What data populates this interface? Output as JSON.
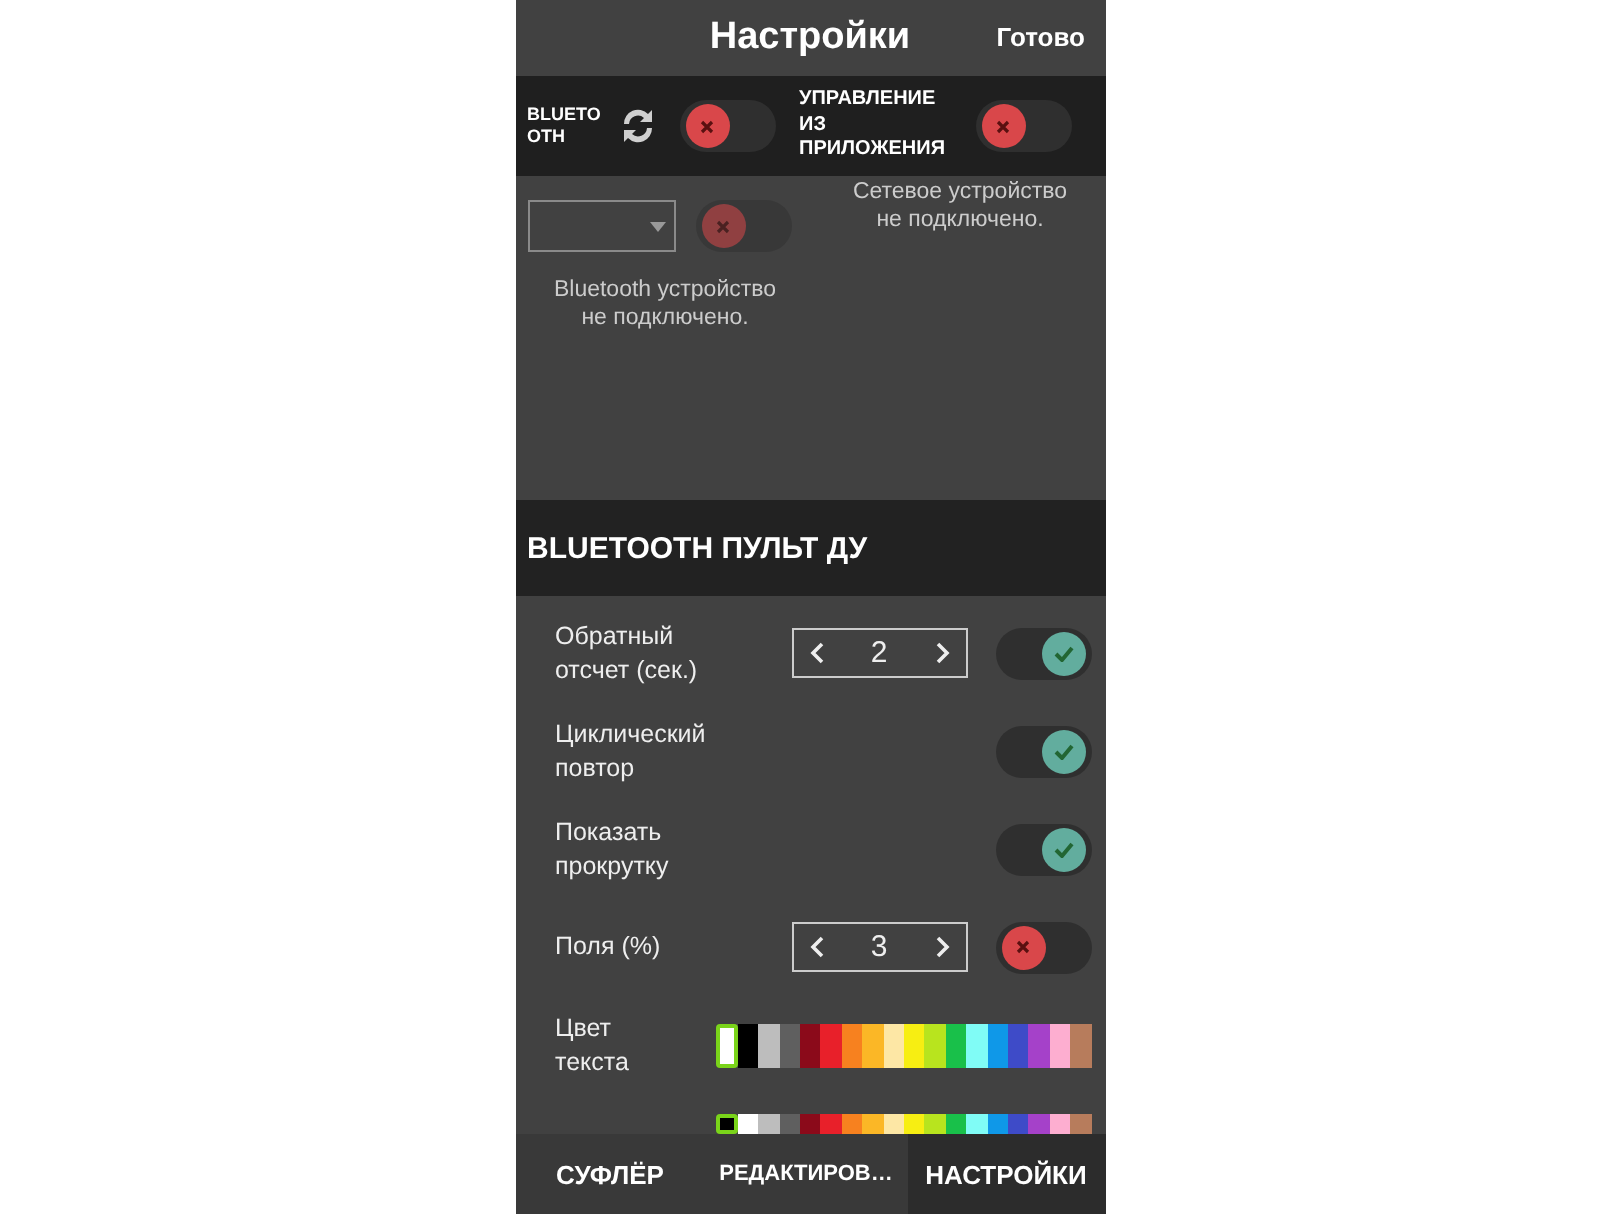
{
  "header": {
    "title": "Настройки",
    "done_button": "Готово"
  },
  "connection_bar": {
    "bluetooth": {
      "label": "BLUETOOTH",
      "on": false
    },
    "app_control": {
      "label": "УПРАВЛЕНИЕ ИЗ ПРИЛОЖЕНИЯ",
      "on": false
    }
  },
  "bluetooth_device": {
    "toggle_on": false,
    "disabled": true,
    "status": "Bluetooth устройство не подключено."
  },
  "network_device": {
    "status": "Сетевое устройство не подключено."
  },
  "section_title": "BLUETOOTH ПУЛЬТ ДУ",
  "rows": [
    {
      "kind": "stepper",
      "label": "Обратный отсчет (сек.)",
      "value": "2",
      "on": true
    },
    {
      "kind": "toggle",
      "label": "Циклический повтор",
      "on": true
    },
    {
      "kind": "toggle",
      "label": "Показать прокрутку",
      "on": true
    },
    {
      "kind": "stepper",
      "label": "Поля (%)",
      "value": "3",
      "on": false
    },
    {
      "kind": "colors",
      "label": "Цвет текста",
      "swatches": [
        {
          "color": "#ffffff",
          "selected": true
        },
        {
          "color": "#000000",
          "selected": false
        },
        {
          "color": "#bdbdbd",
          "selected": false
        },
        {
          "color": "#5f5f5f",
          "selected": false
        },
        {
          "color": "#8b0a1a",
          "selected": false
        },
        {
          "color": "#e8202a",
          "selected": false
        },
        {
          "color": "#f7811f",
          "selected": false
        },
        {
          "color": "#fbb726",
          "selected": false
        },
        {
          "color": "#fde7a5",
          "selected": false
        },
        {
          "color": "#f7ee12",
          "selected": false
        },
        {
          "color": "#b8e41e",
          "selected": false
        },
        {
          "color": "#19c04a",
          "selected": false
        },
        {
          "color": "#80fcf6",
          "selected": false
        },
        {
          "color": "#0f98e8",
          "selected": false
        },
        {
          "color": "#3e4bc8",
          "selected": false
        },
        {
          "color": "#a541c9",
          "selected": false
        },
        {
          "color": "#fdaed0",
          "selected": false
        },
        {
          "color": "#b77c5c",
          "selected": false
        }
      ]
    },
    {
      "kind": "colors",
      "swatches": [
        {
          "color": "#000000",
          "selected": true
        },
        {
          "color": "#ffffff",
          "selected": false
        },
        {
          "color": "#bdbdbd",
          "selected": false
        },
        {
          "color": "#5f5f5f",
          "selected": false
        },
        {
          "color": "#8b0a1a",
          "selected": false
        },
        {
          "color": "#e8202a",
          "selected": false
        },
        {
          "color": "#f7811f",
          "selected": false
        },
        {
          "color": "#fbb726",
          "selected": false
        },
        {
          "color": "#fde7a5",
          "selected": false
        },
        {
          "color": "#f7ee12",
          "selected": false
        },
        {
          "color": "#b8e41e",
          "selected": false
        },
        {
          "color": "#19c04a",
          "selected": false
        },
        {
          "color": "#80fcf6",
          "selected": false
        },
        {
          "color": "#0f98e8",
          "selected": false
        },
        {
          "color": "#3e4bc8",
          "selected": false
        },
        {
          "color": "#a541c9",
          "selected": false
        },
        {
          "color": "#fdaed0",
          "selected": false
        },
        {
          "color": "#b77c5c",
          "selected": false
        }
      ]
    }
  ],
  "tabs": [
    {
      "label": "СУФЛЁР",
      "selected": false
    },
    {
      "label": "РЕДАКТИРОВ…",
      "selected": false
    },
    {
      "label": "НАСТРОЙКИ",
      "selected": true
    }
  ]
}
